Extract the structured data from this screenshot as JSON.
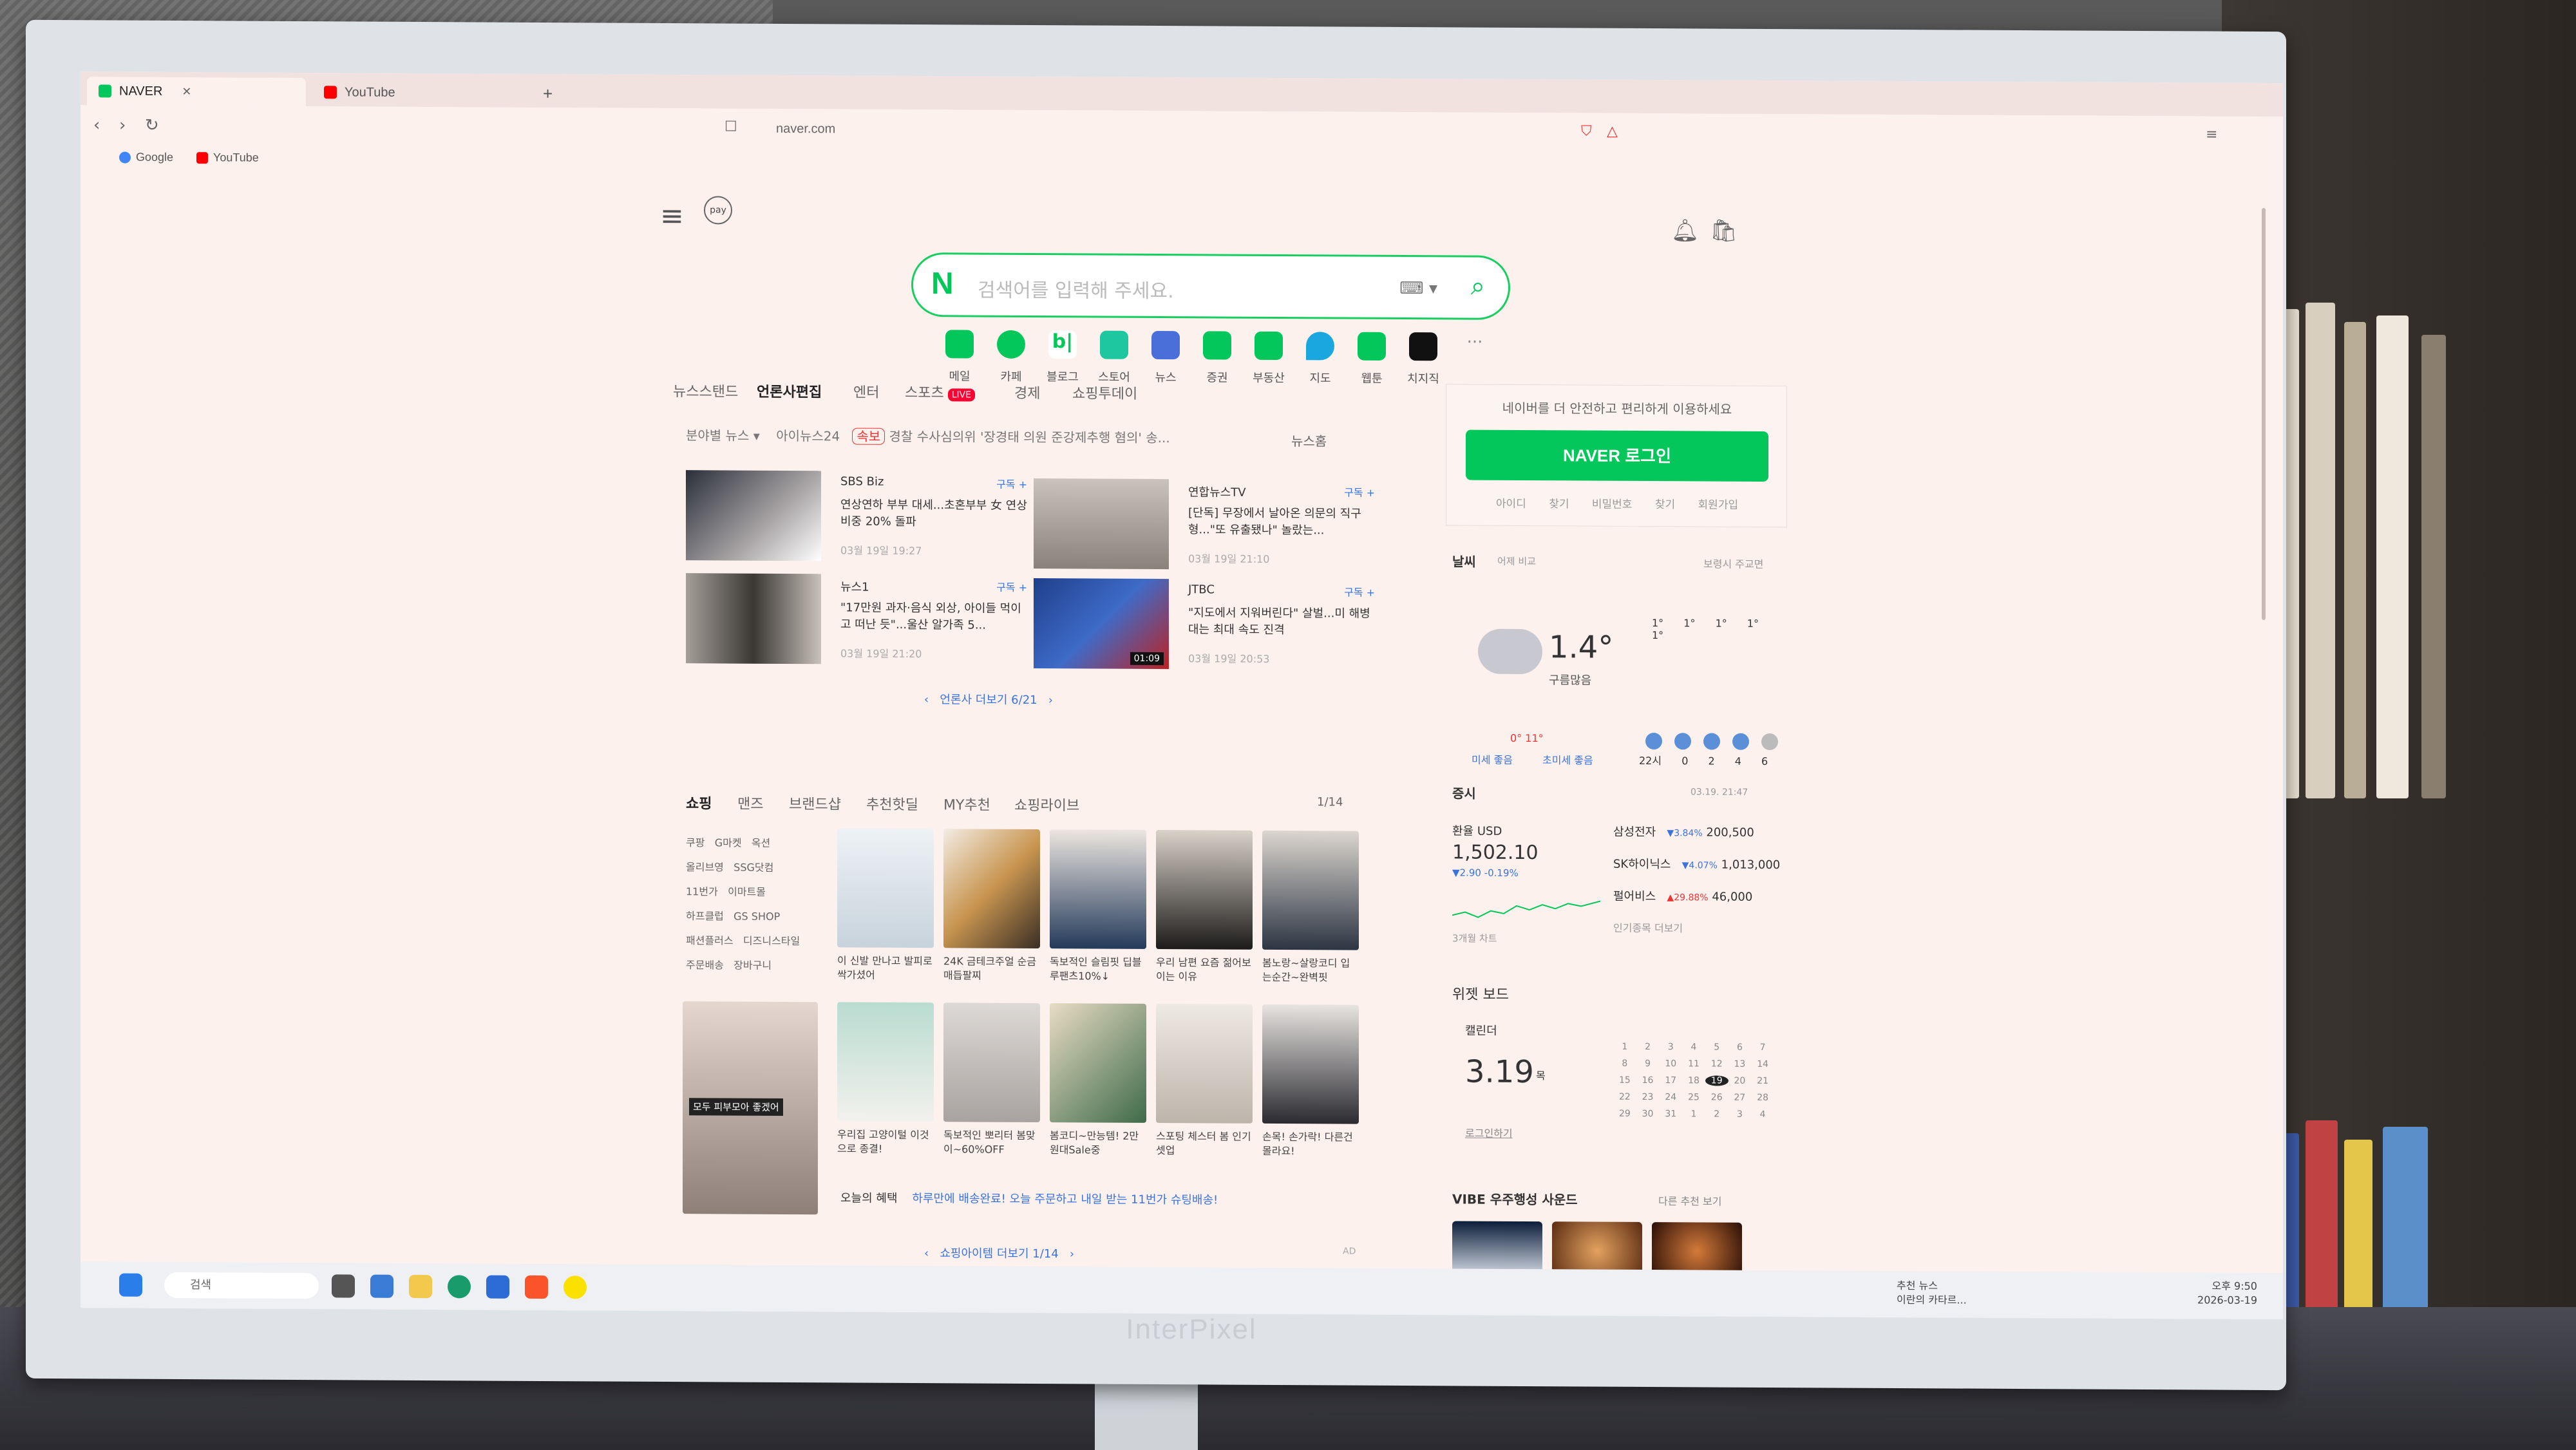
{
  "browser": {
    "tabs": [
      {
        "label": "NAVER",
        "active": true
      },
      {
        "label": "YouTube",
        "active": false
      }
    ],
    "url": "naver.com",
    "bookmarks": [
      "Google",
      "YouTube"
    ]
  },
  "naver": {
    "search_placeholder": "검색어를 입력해 주세요.",
    "services": [
      "메일",
      "카페",
      "블로그",
      "스토어",
      "뉴스",
      "증권",
      "부동산",
      "지도",
      "웹툰",
      "치지직"
    ],
    "news": {
      "tabs": [
        "뉴스스탠드",
        "언론사편집",
        "엔터",
        "스포츠",
        "경제",
        "쇼핑투데이"
      ],
      "live": "LIVE",
      "filter": "분야별 뉴스",
      "ticker_source": "아이뉴스24",
      "ticker_badge": "속보",
      "ticker_text": "경찰 수사심의위 '장경태 의원 준강제추행 혐의' 송...",
      "news_home": "뉴스홈",
      "cards": [
        {
          "source": "SBS Biz",
          "subscribe": "구독 +",
          "title": "연상연하 부부 대세...초혼부부 女 연상 비중 20% 돌파",
          "date": "03월 19일 19:27"
        },
        {
          "source": "연합뉴스TV",
          "subscribe": "구독 +",
          "title": "[단독] 무장에서 날아온 의문의 직구형...\"또 유출됐나\" 놀랐는...",
          "date": "03월 19일 21:10"
        },
        {
          "source": "뉴스1",
          "subscribe": "구독 +",
          "title": "\"17만원 과자·음식 외상, 아이들 먹이고 떠난 듯\"...울산 알가족 5...",
          "date": "03월 19일 21:20"
        },
        {
          "source": "JTBC",
          "subscribe": "구독 +",
          "title": "\"지도에서 지워버린다\" 살벌...미 해병대는 최대 속도 진격",
          "date": "03월 19일 20:53",
          "duration": "01:09"
        }
      ],
      "pager": "언론사 더보기 6/21"
    },
    "shopping": {
      "tabs": [
        "쇼핑",
        "맨즈",
        "브랜드샵",
        "추천핫딜",
        "MY추천",
        "쇼핑라이브"
      ],
      "page": "1/14",
      "links": [
        "쿠팡",
        "G마켓",
        "옥션",
        "올리브영",
        "SSG닷컴",
        "11번가",
        "이마트몰",
        "하프클럽",
        "GS SHOP",
        "패션플러스",
        "디즈니스타일",
        "주문배송",
        "장바구니"
      ],
      "products": [
        "이 신발 만나고 발피로 싹가셨어",
        "24K 금테크주얼 순금 매듭팔찌",
        "독보적인 슬림핏 딥블루팬츠10%↓",
        "우리 남편 요즘 젊어보이는 이유",
        "봄노랑~살랑코디 입는순간~완벽핏",
        "우리집 고양이털 이것으로 종결!",
        "독보적인 뽀리터 봄맞이~60%OFF",
        "봄코디~만능템! 2만원대Sale중",
        "스포팅 체스터 봄 인기 셋업",
        "손목! 손가락! 다른건 몰라요!"
      ],
      "promo_thumb_caption": "모두 피부모아 좋겠어",
      "benefit_label": "오늘의 혜택",
      "benefit_text": "하루만에 배송완료! 오늘 주문하고 내일 받는 11번가 슈팅배송!",
      "pager": "쇼핑아이템 더보기 1/14",
      "ad": "AD"
    },
    "login": {
      "message": "네이버를 더 안전하고 편리하게 이용하세요",
      "button": "NAVER 로그인",
      "links": [
        "아이디 찾기",
        "비밀번호 찾기",
        "회원가입"
      ]
    },
    "weather": {
      "title": "날씨",
      "compare": "어제 비교",
      "location": "보령시 주교면",
      "temp": "1.4°",
      "condition": "구름많음",
      "range": "0° 11°",
      "dust": "미세 좋음",
      "ultra_dust": "초미세 좋음",
      "hours": [
        "22시",
        "0",
        "2",
        "4",
        "6"
      ],
      "hourly_temps": [
        "1°",
        "1°",
        "1°",
        "1°",
        "1°"
      ]
    },
    "stocks": {
      "title": "증시",
      "updated": "03.19. 21:47",
      "fx_label": "환율 USD",
      "fx_value": "1,502.10",
      "fx_change": "▼2.90 -0.19%",
      "period": "3개월 차트",
      "items": [
        {
          "name": "삼성전자",
          "change": "▼3.84%",
          "price": "200,500"
        },
        {
          "name": "SK하이닉스",
          "change": "▼4.07%",
          "price": "1,013,000"
        },
        {
          "name": "펄어비스",
          "change": "▲29.88%",
          "price": "46,000"
        }
      ],
      "more": "인기종목 더보기"
    },
    "widget": {
      "title": "위젯 보드",
      "calendar_label": "캘린더",
      "date": "3.19",
      "weekday": "목",
      "login_link": "로그인하기",
      "vibe": "VIBE 우주행성 사운드",
      "vibe_more": "다른 추천 보기"
    }
  },
  "taskbar": {
    "search_label": "검색",
    "news_widget": "추천 뉴스",
    "news_widget_sub": "이란의 카타르...",
    "time": "오후 9:50",
    "date": "2026-03-19"
  },
  "monitor_brand": "InterPixel"
}
